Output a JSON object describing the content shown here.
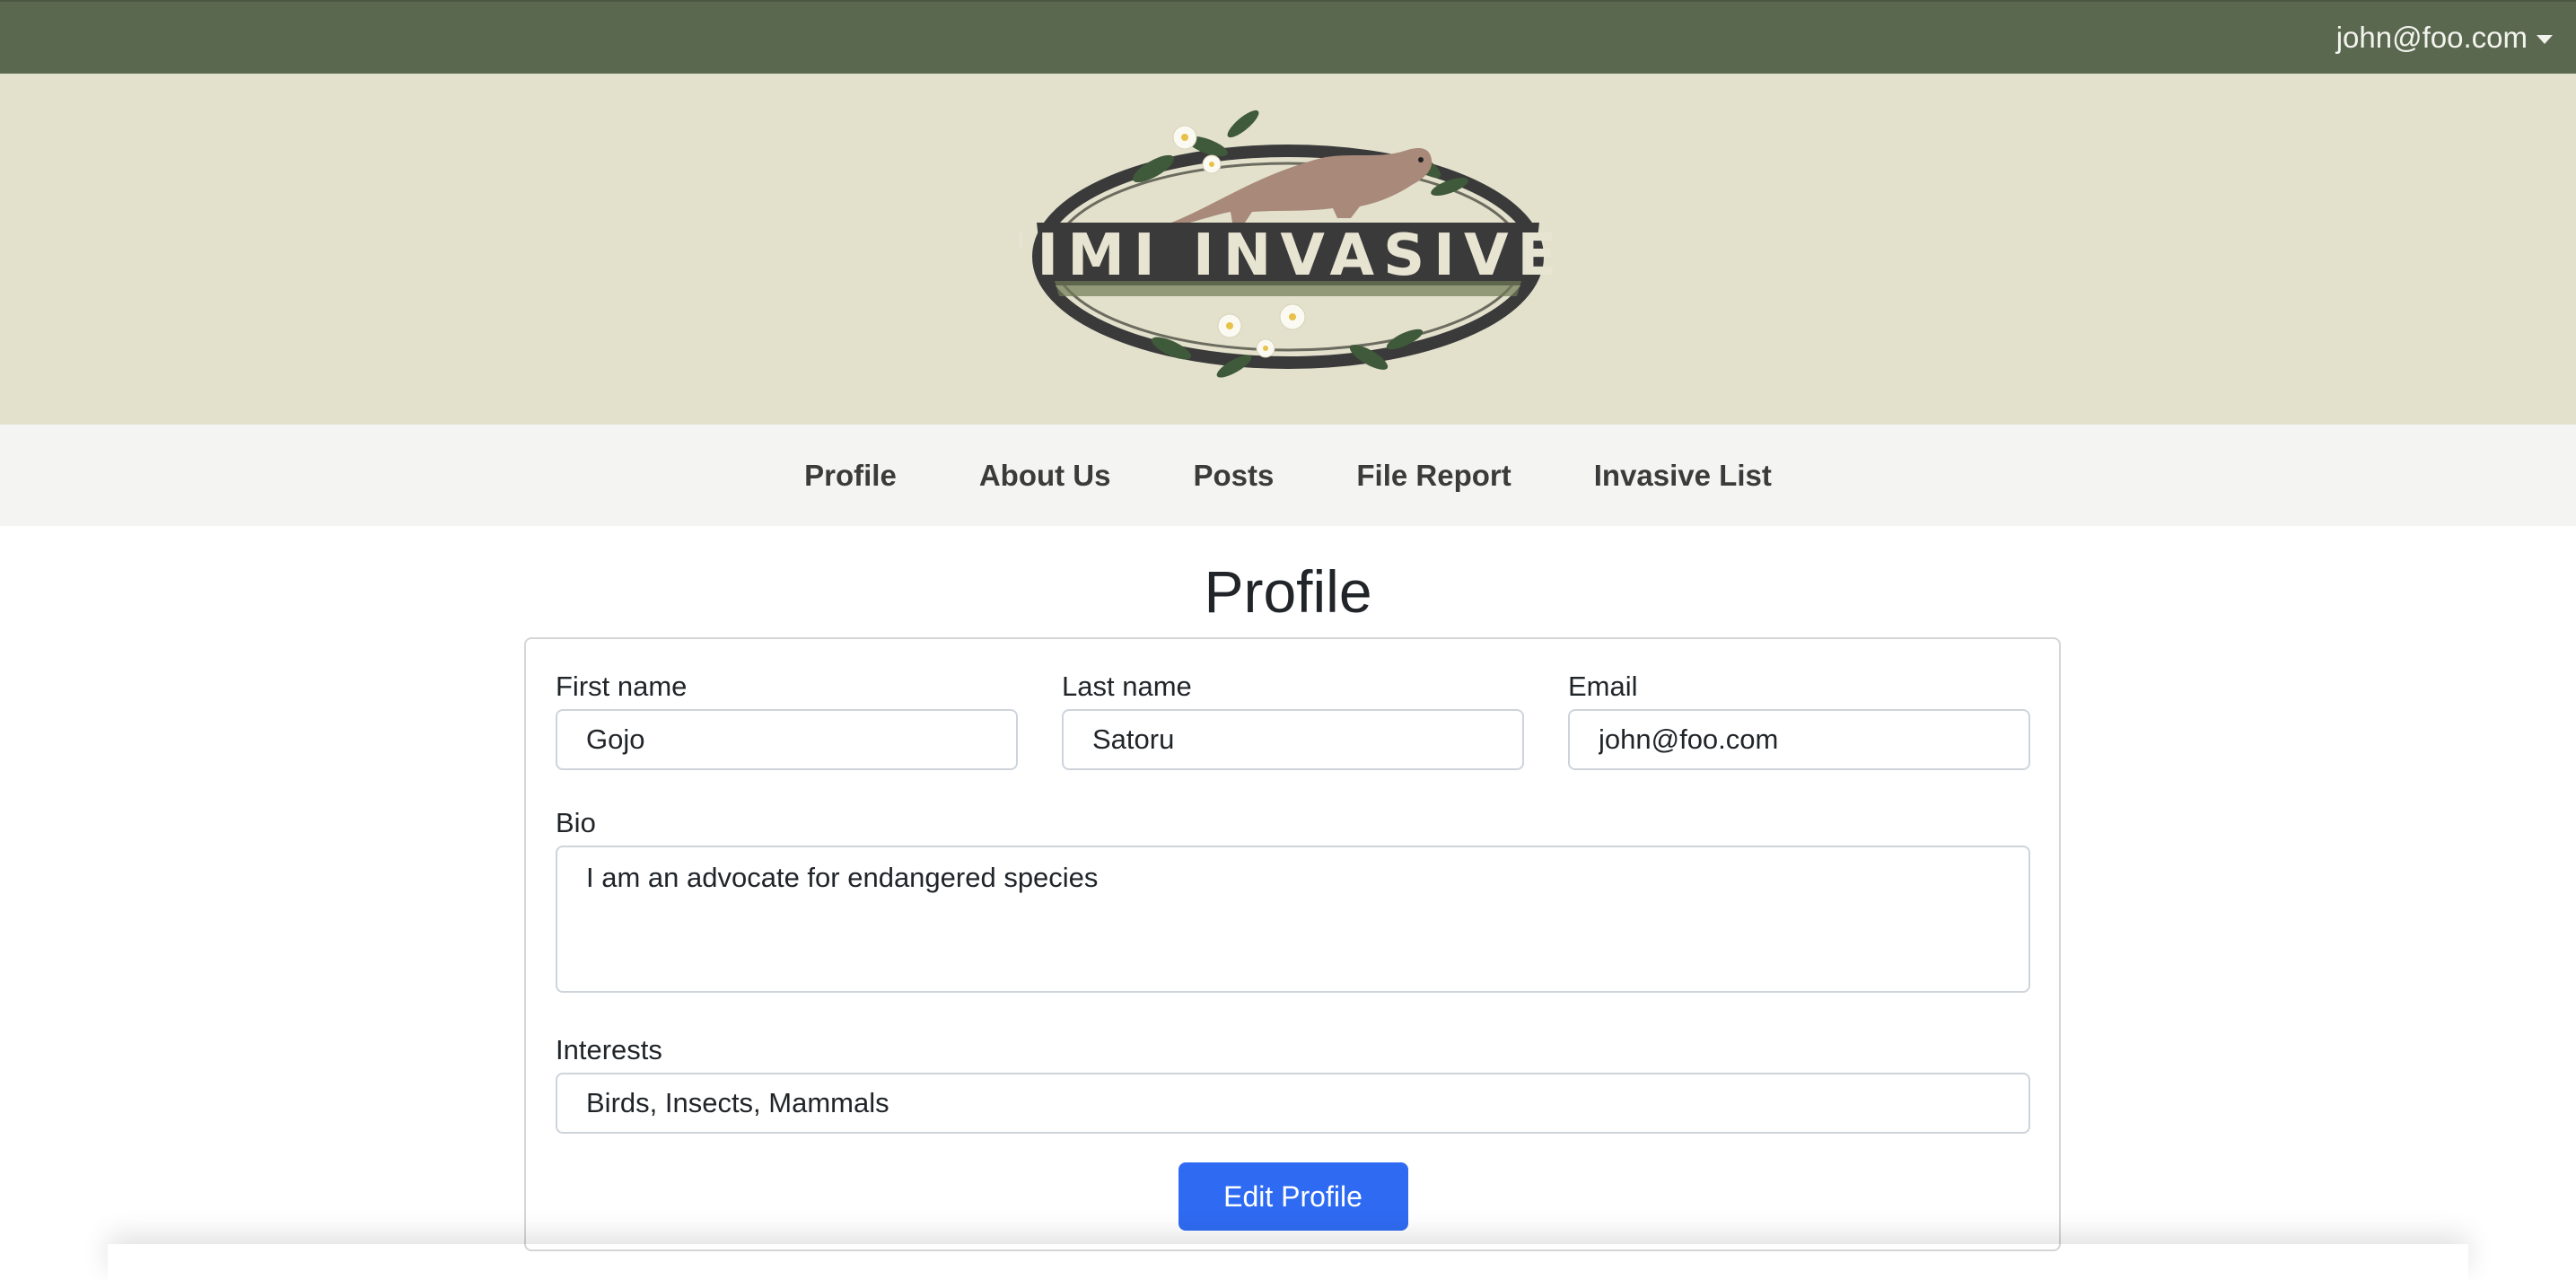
{
  "topbar": {
    "user_email": "john@foo.com"
  },
  "banner": {
    "logo_text": "'IMI INVASIVE"
  },
  "nav": {
    "items": [
      {
        "label": "Profile"
      },
      {
        "label": "About Us"
      },
      {
        "label": "Posts"
      },
      {
        "label": "File Report"
      },
      {
        "label": "Invasive List"
      }
    ]
  },
  "page": {
    "title": "Profile"
  },
  "form": {
    "first_name": {
      "label": "First name",
      "value": "Gojo"
    },
    "last_name": {
      "label": "Last name",
      "value": "Satoru"
    },
    "email": {
      "label": "Email",
      "value": "john@foo.com"
    },
    "bio": {
      "label": "Bio",
      "value": "I am an advocate for endangered species"
    },
    "interests": {
      "label": "Interests",
      "value": "Birds, Insects, Mammals"
    },
    "submit_label": "Edit Profile"
  },
  "colors": {
    "topbar": "#5b6850",
    "banner": "#e3e1cc",
    "navbar": "#f4f4f3",
    "button": "#2f6bf2"
  }
}
